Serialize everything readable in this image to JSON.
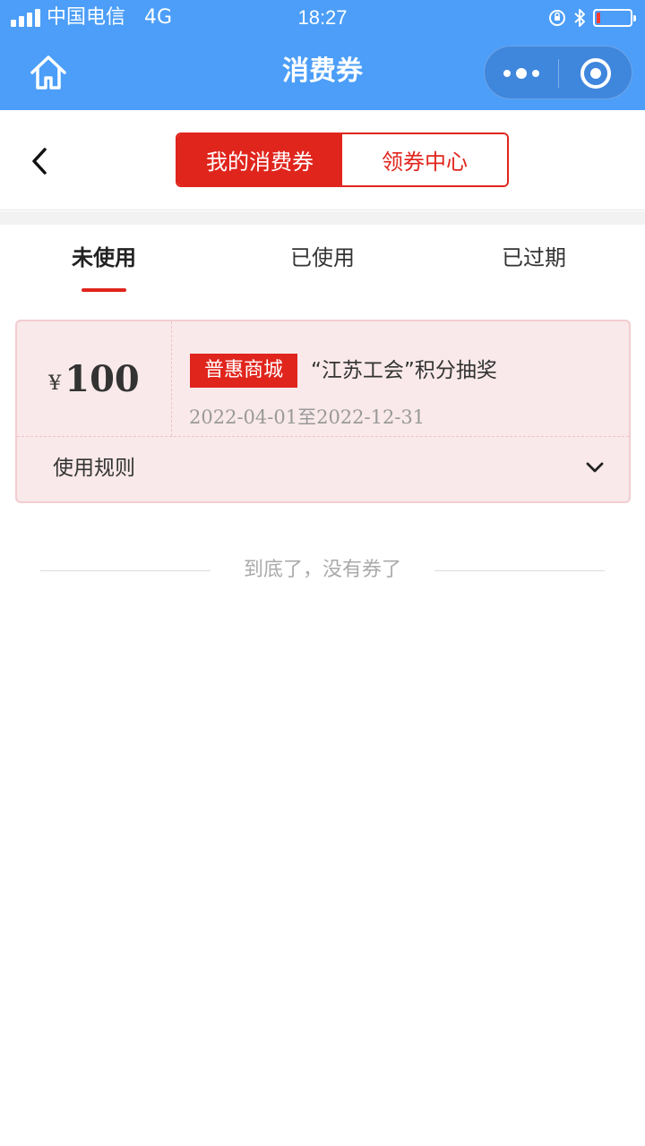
{
  "status_bar": {
    "carrier": "中国电信",
    "network": "4G",
    "time": "18:27",
    "battery_level": 0.1,
    "battery_color": "#ff3b30",
    "icons": [
      "signal-icon",
      "orientation-lock-icon",
      "bluetooth-icon",
      "battery-icon"
    ]
  },
  "nav": {
    "title": "消费券",
    "left_icon": "home-icon",
    "capsule_icons": [
      "more-icon",
      "close-mini-program-icon"
    ],
    "background": "#4c9ef8"
  },
  "header": {
    "back_icon": "chevron-left-icon",
    "segments": [
      {
        "label": "我的消费券",
        "active": true
      },
      {
        "label": "领券中心",
        "active": false
      }
    ],
    "accent": "#e0251d"
  },
  "tabs": [
    {
      "label": "未使用",
      "active": true
    },
    {
      "label": "已使用",
      "active": false
    },
    {
      "label": "已过期",
      "active": false
    }
  ],
  "coupons": [
    {
      "currency": "¥",
      "amount": "100",
      "tag": "普惠商城",
      "name": "“江苏工会”积分抽奖",
      "validity": "2022-04-01至2022-12-31",
      "rules_label": "使用规则",
      "expand_icon": "chevron-down-icon"
    }
  ],
  "footer": {
    "end_text": "到底了，没有券了"
  }
}
